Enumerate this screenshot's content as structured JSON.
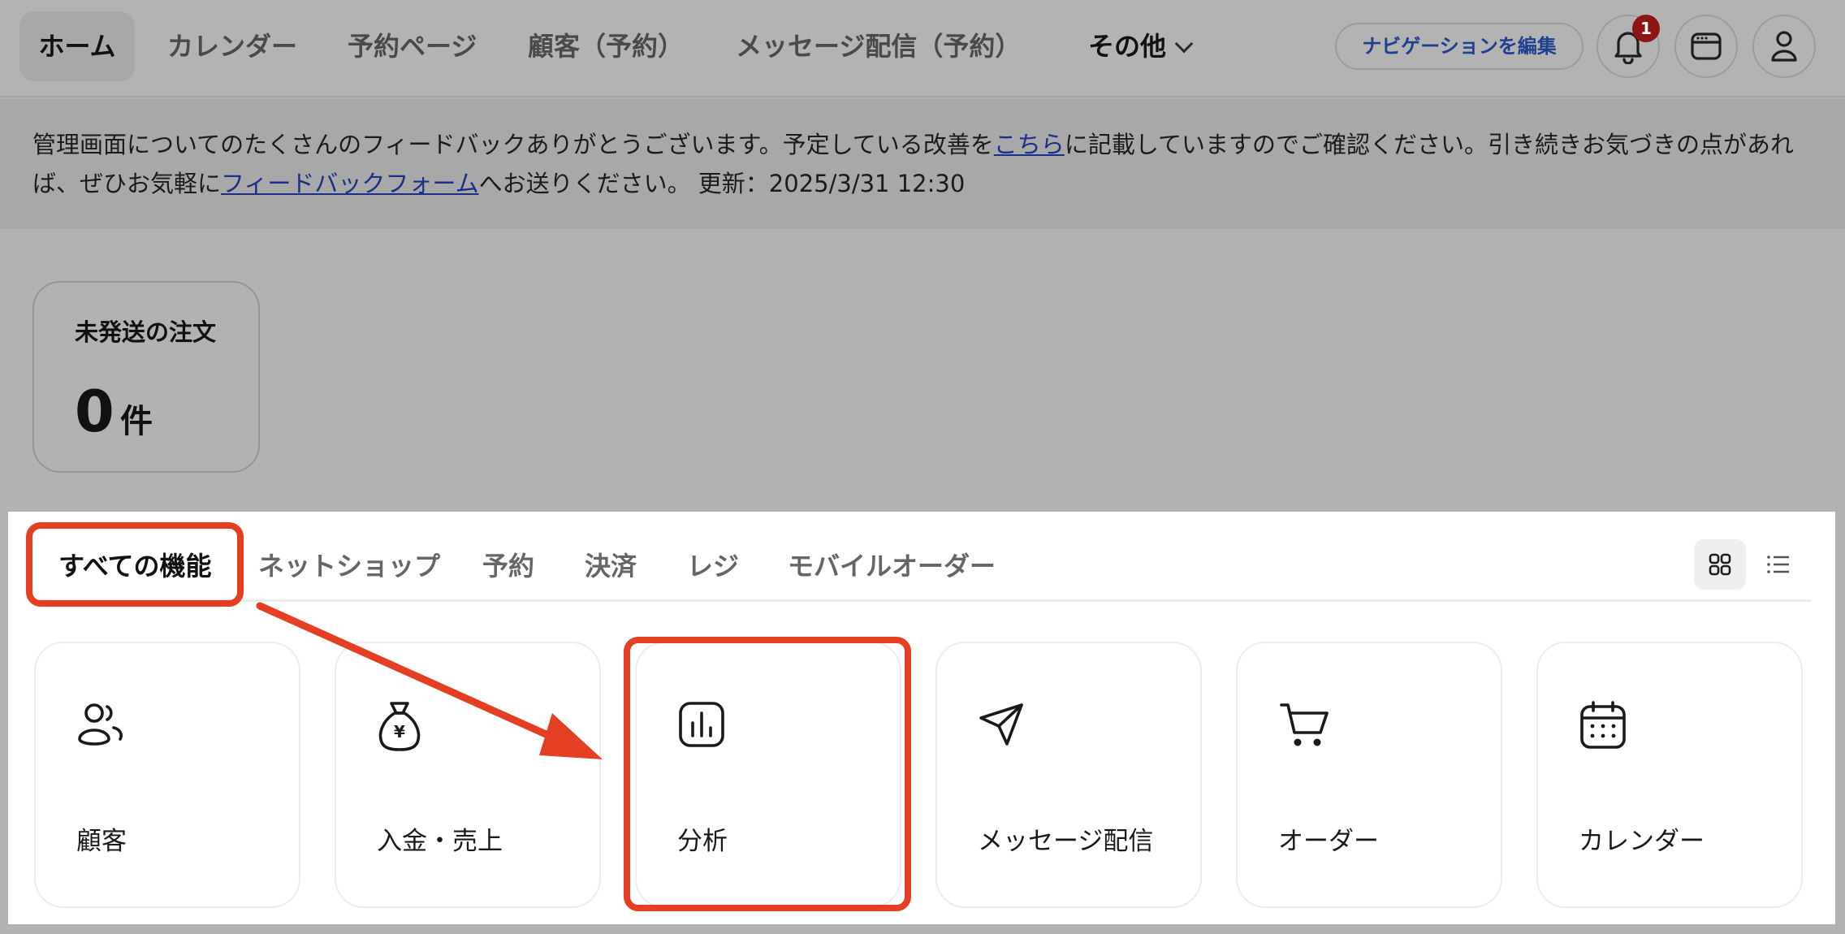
{
  "nav": {
    "items": [
      "ホーム",
      "カレンダー",
      "予約ページ",
      "顧客（予約）",
      "メッセージ配信（予約）"
    ],
    "more_label": "その他",
    "edit_label": "ナビゲーションを編集",
    "notification_count": "1"
  },
  "banner": {
    "text_before_link1": "管理画面についてのたくさんのフィードバックありがとうございます。予定している改善を",
    "link1": "こちら",
    "text_after_link1": "に記載していますのでご確認ください。引き続きお気づきの点があれば、ぜひお気軽に",
    "link2": "フィードバックフォーム",
    "text_after_link2": "へお送りください。 更新：2025/3/31 12:30"
  },
  "order_card": {
    "title": "未発送の注文",
    "count": "0",
    "unit": "件"
  },
  "tabs": [
    "すべての機能",
    "ネットショップ",
    "予約",
    "決済",
    "レジ",
    "モバイルオーダー"
  ],
  "feature_cards": [
    {
      "label": "顧客",
      "icon": "users-icon"
    },
    {
      "label": "入金・売上",
      "icon": "money-bag-yen-icon"
    },
    {
      "label": "分析",
      "icon": "bar-chart-icon"
    },
    {
      "label": "メッセージ配信",
      "icon": "paper-plane-icon"
    },
    {
      "label": "オーダー",
      "icon": "cart-icon"
    },
    {
      "label": "カレンダー",
      "icon": "calendar-icon"
    }
  ],
  "colors": {
    "accent_callout": "#e43e23",
    "overlay_dim": "#b2b2b2",
    "badge": "#8d1515",
    "link": "#1f3f92"
  }
}
